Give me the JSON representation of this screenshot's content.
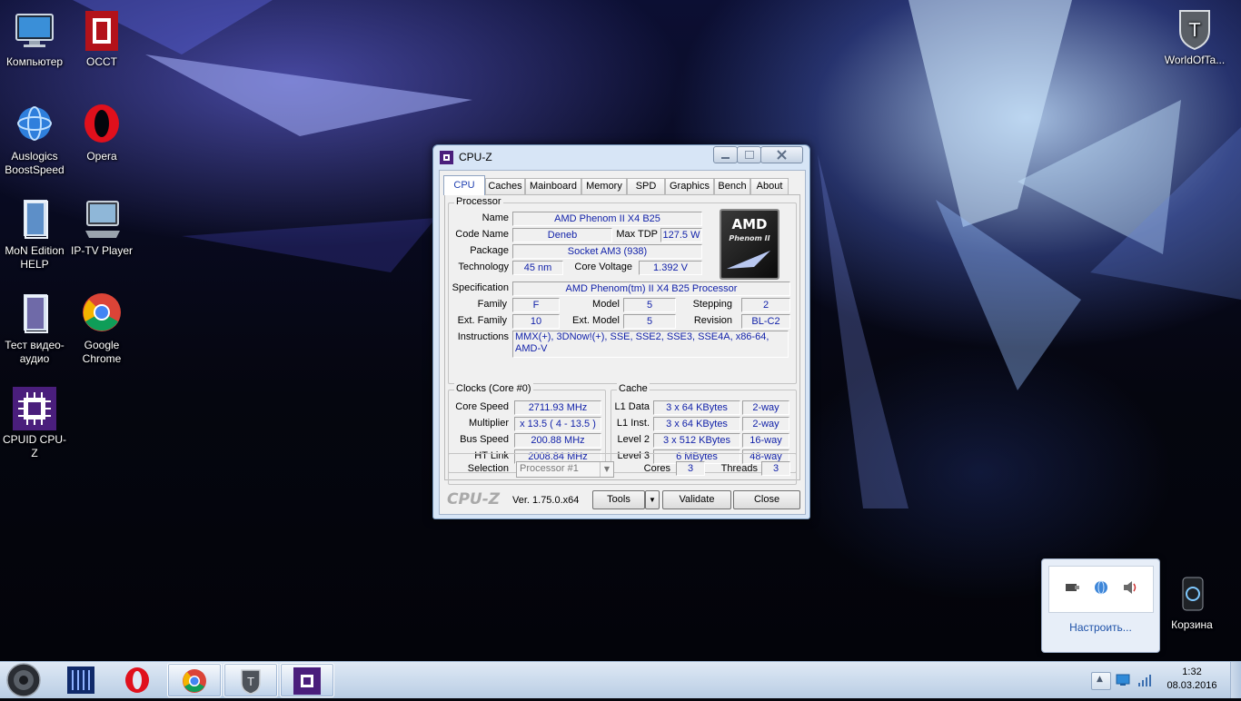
{
  "desktop": {
    "icons": [
      {
        "label": "Компьютер"
      },
      {
        "label": "OCCT"
      },
      {
        "label": "Auslogics BoostSpeed"
      },
      {
        "label": "Opera"
      },
      {
        "label": "MoN Edition HELP"
      },
      {
        "label": "IP-TV Player"
      },
      {
        "label": "Тест видео-аудио"
      },
      {
        "label": "Google Chrome"
      },
      {
        "label": "CPUID CPU-Z"
      },
      {
        "label": "WorldOfTa..."
      },
      {
        "label": "Корзина"
      }
    ]
  },
  "window": {
    "title": "CPU-Z",
    "tabs": [
      "CPU",
      "Caches",
      "Mainboard",
      "Memory",
      "SPD",
      "Graphics",
      "Bench",
      "About"
    ],
    "processor": {
      "group_title": "Processor",
      "name_label": "Name",
      "name": "AMD Phenom II X4 B25",
      "codename_label": "Code Name",
      "codename": "Deneb",
      "maxtdp_label": "Max TDP",
      "maxtdp": "127.5 W",
      "package_label": "Package",
      "package": "Socket AM3 (938)",
      "technology_label": "Technology",
      "technology": "45 nm",
      "voltage_label": "Core Voltage",
      "voltage": "1.392 V",
      "spec_label": "Specification",
      "spec": "AMD Phenom(tm) II X4 B25 Processor",
      "family_label": "Family",
      "family": "F",
      "model_label": "Model",
      "model": "5",
      "stepping_label": "Stepping",
      "stepping": "2",
      "extfamily_label": "Ext. Family",
      "extfamily": "10",
      "extmodel_label": "Ext. Model",
      "extmodel": "5",
      "revision_label": "Revision",
      "revision": "BL-C2",
      "instructions_label": "Instructions",
      "instructions": "MMX(+), 3DNow!(+), SSE, SSE2, SSE3, SSE4A, x86-64, AMD-V",
      "logo_brand": "AMD",
      "logo_line": "Phenom II"
    },
    "clocks": {
      "group_title": "Clocks (Core #0)",
      "corespeed_label": "Core Speed",
      "corespeed": "2711.93 MHz",
      "multiplier_label": "Multiplier",
      "multiplier": "x 13.5 ( 4 - 13.5 )",
      "busspeed_label": "Bus Speed",
      "busspeed": "200.88 MHz",
      "htlink_label": "HT Link",
      "htlink": "2008.84 MHz"
    },
    "cache": {
      "group_title": "Cache",
      "rows": [
        {
          "label": "L1 Data",
          "size": "3 x 64 KBytes",
          "ways": "2-way"
        },
        {
          "label": "L1 Inst.",
          "size": "3 x 64 KBytes",
          "ways": "2-way"
        },
        {
          "label": "Level 2",
          "size": "3 x 512 KBytes",
          "ways": "16-way"
        },
        {
          "label": "Level 3",
          "size": "6 MBytes",
          "ways": "48-way"
        }
      ]
    },
    "selection": {
      "label": "Selection",
      "value": "Processor #1",
      "cores_label": "Cores",
      "cores": "3",
      "threads_label": "Threads",
      "threads": "3"
    },
    "footer": {
      "brand": "CPU-Z",
      "version": "Ver. 1.75.0.x64",
      "tools": "Tools",
      "validate": "Validate",
      "close": "Close"
    }
  },
  "tray": {
    "customize": "Настроить...",
    "time": "1:32",
    "date": "08.03.2016"
  }
}
